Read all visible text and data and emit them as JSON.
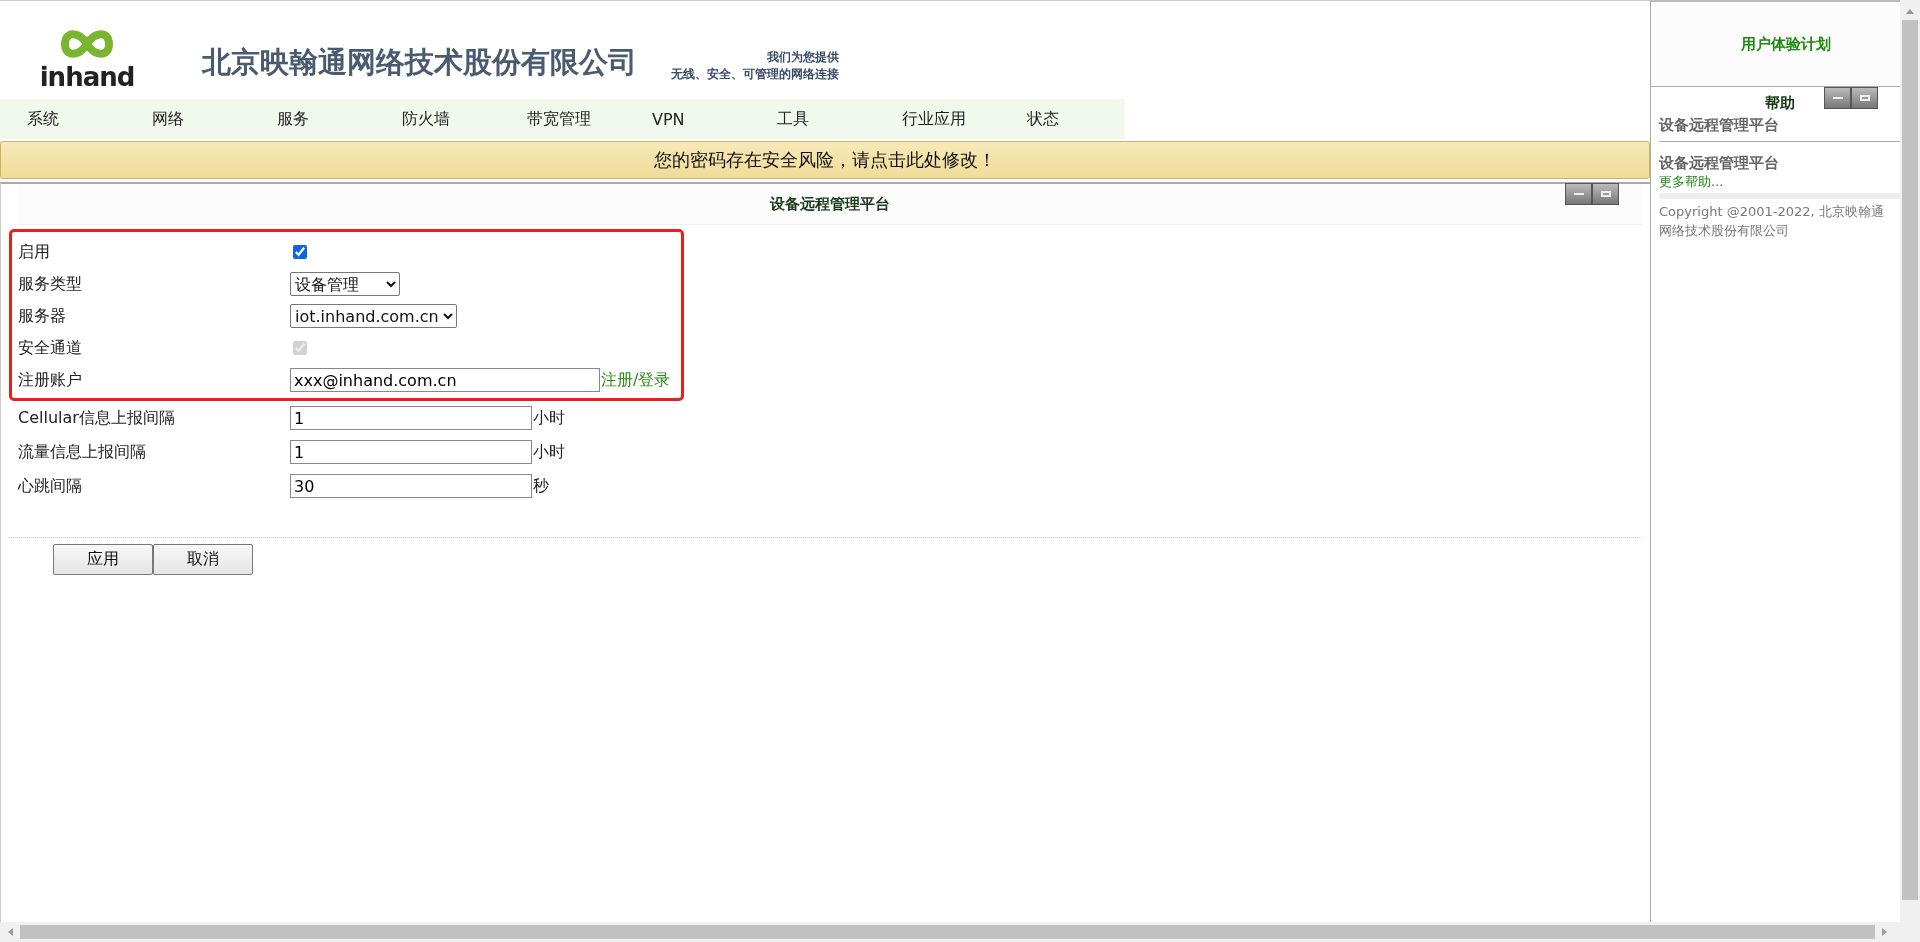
{
  "header": {
    "logo_text": "inhand",
    "company": "北京映翰通网络技术股份有限公司",
    "slogan": [
      "我们为您提供",
      "无线、安全、可管理的网络连接"
    ]
  },
  "nav": [
    {
      "label": "系统"
    },
    {
      "label": "网络"
    },
    {
      "label": "服务"
    },
    {
      "label": "防火墙"
    },
    {
      "label": "带宽管理"
    },
    {
      "label": "VPN"
    },
    {
      "label": "工具"
    },
    {
      "label": "行业应用"
    },
    {
      "label": "状态"
    }
  ],
  "warning": "您的密码存在安全风险，请点击此处修改！",
  "panel": {
    "title": "设备远程管理平台",
    "highlighted_rows": [
      {
        "kind": "checkbox",
        "label": "启用",
        "checked": true,
        "disabled": false
      },
      {
        "kind": "select",
        "label": "服务类型",
        "value": "设备管理"
      },
      {
        "kind": "select",
        "label": "服务器",
        "value": "iot.inhand.com.cn"
      },
      {
        "kind": "checkbox",
        "label": "安全通道",
        "checked": true,
        "disabled": true
      },
      {
        "kind": "text",
        "label": "注册账户",
        "value": "xxx@inhand.com.cn",
        "link": "注册/登录"
      }
    ],
    "rows": [
      {
        "kind": "text",
        "label": "Cellular信息上报间隔",
        "value": "1",
        "unit": "小时"
      },
      {
        "kind": "text",
        "label": "流量信息上报间隔",
        "value": "1",
        "unit": "小时"
      },
      {
        "kind": "text",
        "label": "心跳间隔",
        "value": "30",
        "unit": "秒"
      }
    ],
    "buttons": [
      "应用",
      "取消"
    ]
  },
  "sidebar": {
    "program": "用户体验计划",
    "help_title": "帮助",
    "help_items": [
      "设备远程管理平台",
      "设备远程管理平台"
    ],
    "more": "更多帮助...",
    "copyright": "Copyright @2001-2022, 北京映翰通网络技术股份有限公司"
  }
}
